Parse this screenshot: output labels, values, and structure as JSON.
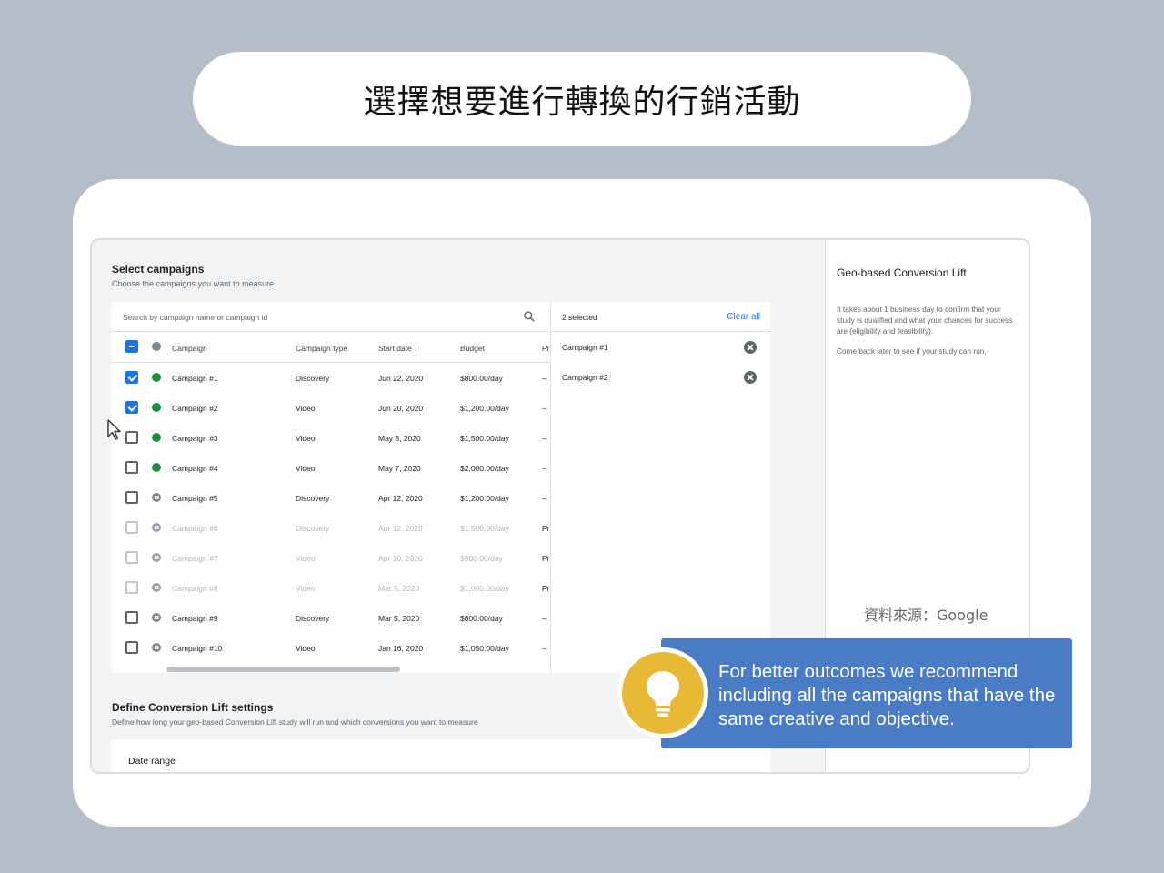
{
  "header": {
    "title": "選擇想要進行轉換的行銷活動"
  },
  "select_campaigns": {
    "title": "Select campaigns",
    "subtitle": "Choose the campaigns you want to measure",
    "search_placeholder": "Search by campaign name or campaign id",
    "columns": {
      "campaign": "Campaign",
      "type": "Campaign type",
      "start": "Start date ↓",
      "budget": "Budget",
      "pr": "Pr"
    },
    "rows": [
      {
        "name": "Campaign #1",
        "type": "Discovery",
        "start": "Jun 22, 2020",
        "budget": "$800.00/day",
        "pr": "–",
        "checked": true,
        "status": "green",
        "dim": false
      },
      {
        "name": "Campaign #2",
        "type": "Video",
        "start": "Jun 20, 2020",
        "budget": "$1,200.00/day",
        "pr": "–",
        "checked": true,
        "status": "green",
        "dim": false
      },
      {
        "name": "Campaign #3",
        "type": "Video",
        "start": "May 8, 2020",
        "budget": "$1,500.00/day",
        "pr": "–",
        "checked": false,
        "status": "green",
        "dim": false
      },
      {
        "name": "Campaign #4",
        "type": "Video",
        "start": "May 7, 2020",
        "budget": "$2,000.00/day",
        "pr": "–",
        "checked": false,
        "status": "green",
        "dim": false
      },
      {
        "name": "Campaign #5",
        "type": "Discovery",
        "start": "Apr 12, 2020",
        "budget": "$1,200.00/day",
        "pr": "–",
        "checked": false,
        "status": "paused",
        "dim": false
      },
      {
        "name": "Campaign #6",
        "type": "Discovery",
        "start": "Apr 12, 2020",
        "budget": "$1,500.00/day",
        "pr": "Pr",
        "checked": false,
        "status": "paused",
        "dim": true
      },
      {
        "name": "Campaign #7",
        "type": "Video",
        "start": "Apr 10, 2020",
        "budget": "$500.00/day",
        "pr": "Pr",
        "checked": false,
        "status": "paused",
        "dim": true
      },
      {
        "name": "Campaign #8",
        "type": "Video",
        "start": "Mar 5, 2020",
        "budget": "$1,000.00/day",
        "pr": "Pr",
        "checked": false,
        "status": "paused",
        "dim": true
      },
      {
        "name": "Campaign #9",
        "type": "Discovery",
        "start": "Mar 5, 2020",
        "budget": "$800.00/day",
        "pr": "–",
        "checked": false,
        "status": "paused",
        "dim": false
      },
      {
        "name": "Campaign #10",
        "type": "Video",
        "start": "Jan 16, 2020",
        "budget": "$1,050.00/day",
        "pr": "–",
        "checked": false,
        "status": "paused",
        "dim": false
      }
    ],
    "selected_count": "2 selected",
    "clear_all": "Clear all",
    "selected_items": [
      "Campaign #1",
      "Campaign #2"
    ]
  },
  "define_settings": {
    "title": "Define Conversion Lift settings",
    "subtitle": "Define how long your geo-based Conversion Lift study will run and which conversions you want to measure",
    "date_range": "Date range"
  },
  "side_panel": {
    "title": "Geo-based Conversion Lift",
    "text": "It takes about 1 business day to confirm that your study is qualified and what your chances for success are (eligibility and feasibility).",
    "text2": "Come back later to see if your study can run."
  },
  "source": "資料來源：Google",
  "tip": {
    "text": "For better outcomes we recommend including all the campaigns that have the same creative and objective.",
    "icon": "lightbulb-icon"
  },
  "colors": {
    "accent": "#1a73e8",
    "active": "#1e8e3e",
    "banner": "#4a7bc5",
    "bulb": "#e8b935"
  }
}
